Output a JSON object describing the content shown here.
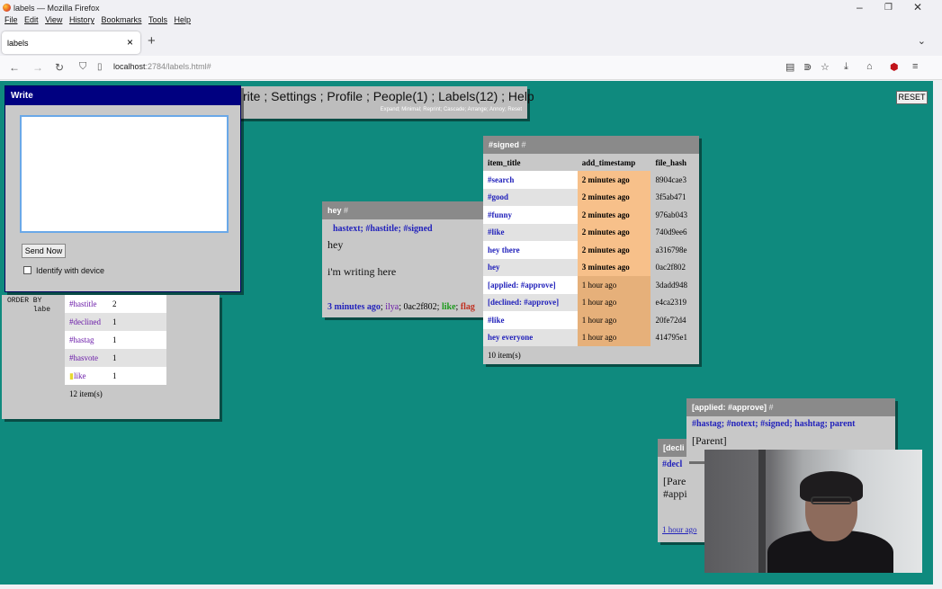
{
  "browser": {
    "window_title": "labels — Mozilla Firefox",
    "menu": [
      "File",
      "Edit",
      "View",
      "History",
      "Bookmarks",
      "Tools",
      "Help"
    ],
    "tab_label": "labels",
    "url_host": "localhost",
    "url_rest": ":2784/labels.html#"
  },
  "topmenu": {
    "links": "rite ; Settings ; Profile ; People(1) ; Labels(12) ; Help",
    "sub": "Expand; Minimal; Reprint; Cascade; Arrange; Annoy; Reset"
  },
  "reset_label": "RESET",
  "write": {
    "title": "Write",
    "send_label": "Send Now",
    "identify_label": "Identify with device"
  },
  "labels_panel": {
    "orderby": "ORDER BY\n      labe",
    "rows": [
      {
        "label": "#hastitle",
        "count": "2"
      },
      {
        "label": "#declined",
        "count": "1"
      },
      {
        "label": "#hastag",
        "count": "1"
      },
      {
        "label": "#hasvote",
        "count": "1"
      },
      {
        "label": "like",
        "count": "1"
      }
    ],
    "footer": "12 item(s)"
  },
  "hey": {
    "title": "hey",
    "hash": "#",
    "tags": [
      "hastext;",
      "#hastitle;",
      "#signed"
    ],
    "body1": "hey",
    "body2": "i'm writing here",
    "meta_time": "3 minutes ago",
    "meta_user": "ilya",
    "meta_hash": "0ac2f802;",
    "meta_like": "like",
    "meta_flag": "flag"
  },
  "signed": {
    "title": "#signed",
    "hash": "#",
    "columns": [
      "item_title",
      "add_timestamp",
      "file_hash"
    ],
    "rows": [
      {
        "title": "#search",
        "time": "2 minutes ago",
        "hash": "8904cae3"
      },
      {
        "title": "#good",
        "time": "2 minutes ago",
        "hash": "3f5ab471"
      },
      {
        "title": "#funny",
        "time": "2 minutes ago",
        "hash": "976ab043"
      },
      {
        "title": "#like",
        "time": "2 minutes ago",
        "hash": "740d9ee6"
      },
      {
        "title": "hey there",
        "time": "2 minutes ago",
        "hash": "a316798e"
      },
      {
        "title": "hey",
        "time": "3 minutes ago",
        "hash": "0ac2f802"
      },
      {
        "title": "[applied: #approve]",
        "time": "1 hour ago",
        "hash": "3dadd948"
      },
      {
        "title": "[declined: #approve]",
        "time": "1 hour ago",
        "hash": "e4ca2319"
      },
      {
        "title": "#like",
        "time": "1 hour ago",
        "hash": "20fe72d4"
      },
      {
        "title": "hey everyone",
        "time": "1 hour ago",
        "hash": "414795e1"
      }
    ],
    "footer": "10 item(s)"
  },
  "declined": {
    "title": "[decli",
    "tag": "#decl",
    "body1": "[Pare",
    "body2": "#appi",
    "meta": "1 hour ago"
  },
  "approve": {
    "title": "[applied: #approve]",
    "hash": "#",
    "tags": "#hastag; #notext; #signed; hashtag; parent",
    "body": "[Parent]"
  }
}
